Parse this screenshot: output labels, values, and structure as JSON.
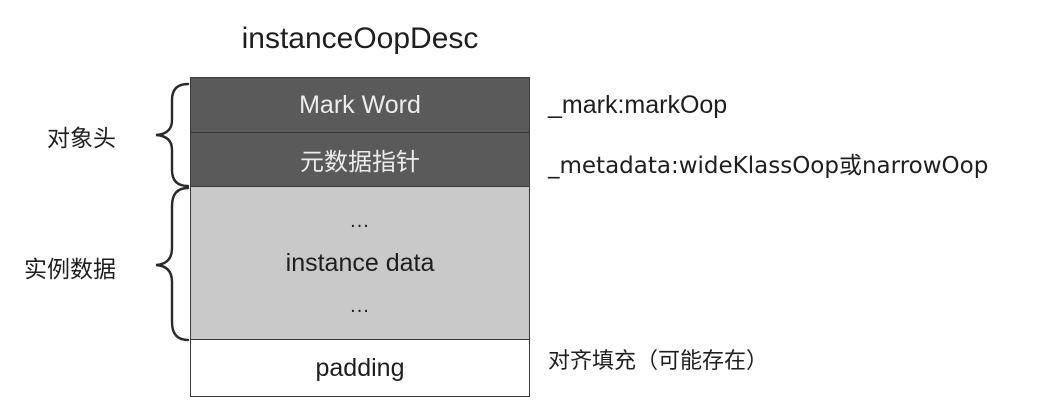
{
  "title": "instanceOopDesc",
  "blocks": {
    "mark_word": "Mark Word",
    "metadata_pointer": "元数据指针",
    "instance_dots_top": "...",
    "instance_data": "instance data",
    "instance_dots_bottom": "...",
    "padding": "padding"
  },
  "right_labels": {
    "mark": "_mark:markOop",
    "metadata": "_metadata:wideKlassOop或narrowOop",
    "padding": "对齐填充（可能存在）"
  },
  "left_labels": {
    "object_header": "对象头",
    "instance_data": "实例数据"
  }
}
